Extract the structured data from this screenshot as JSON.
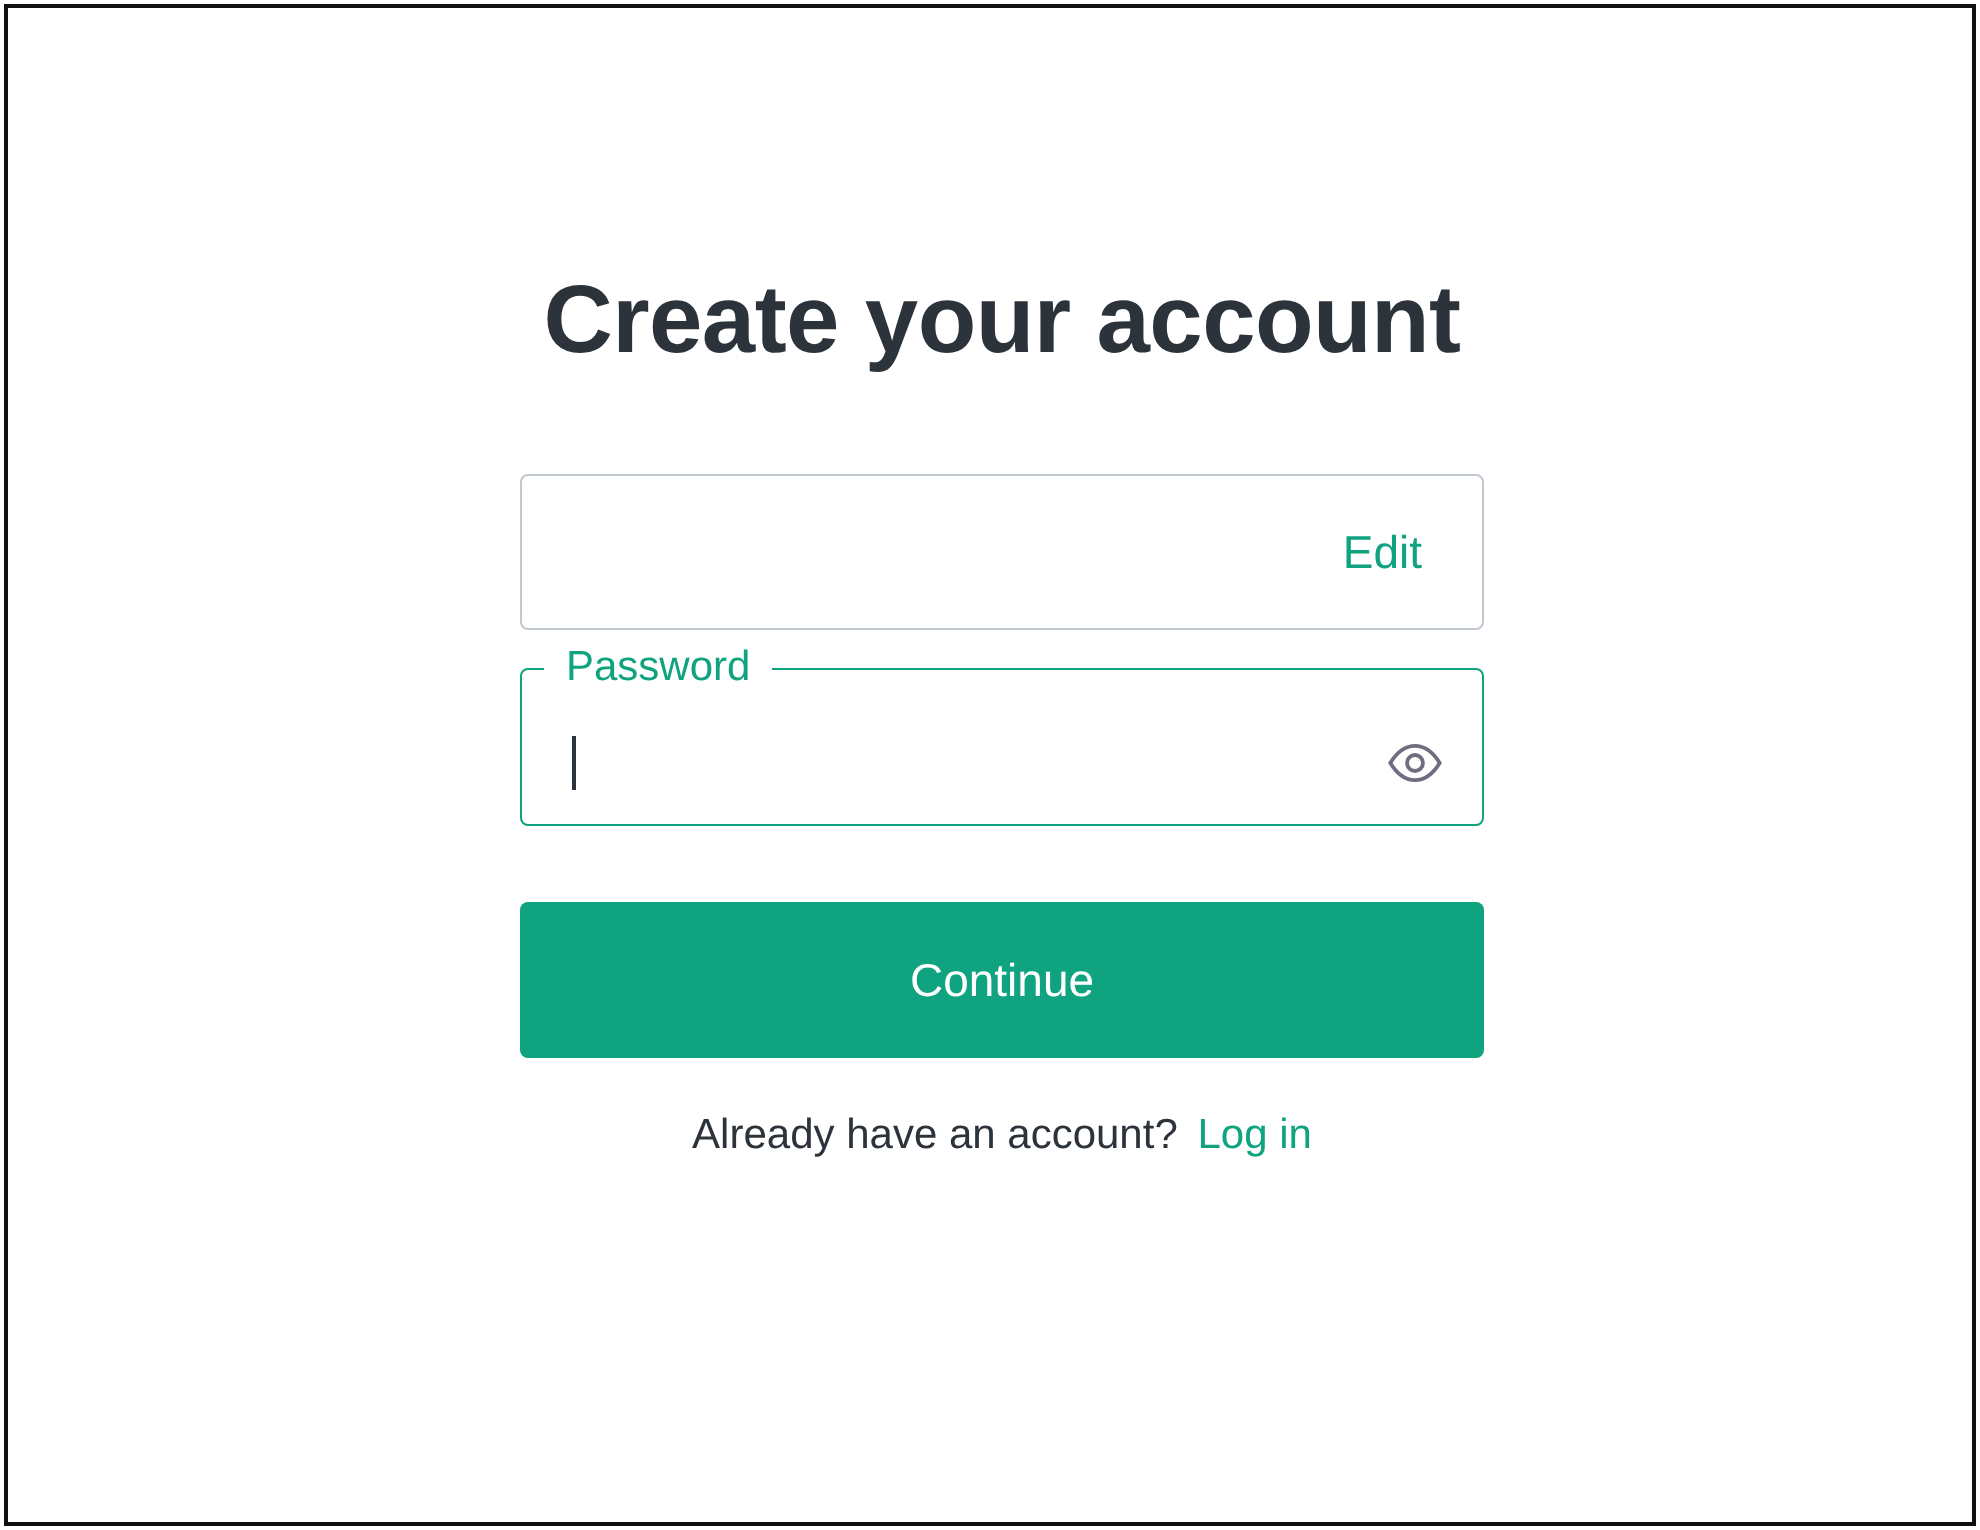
{
  "heading": "Create your account",
  "email_field": {
    "action": "Edit"
  },
  "password_field": {
    "label": "Password",
    "focused": true
  },
  "continue_button": {
    "label": "Continue"
  },
  "login_prompt": {
    "text": "Already have an account?",
    "link": "Log in"
  }
}
